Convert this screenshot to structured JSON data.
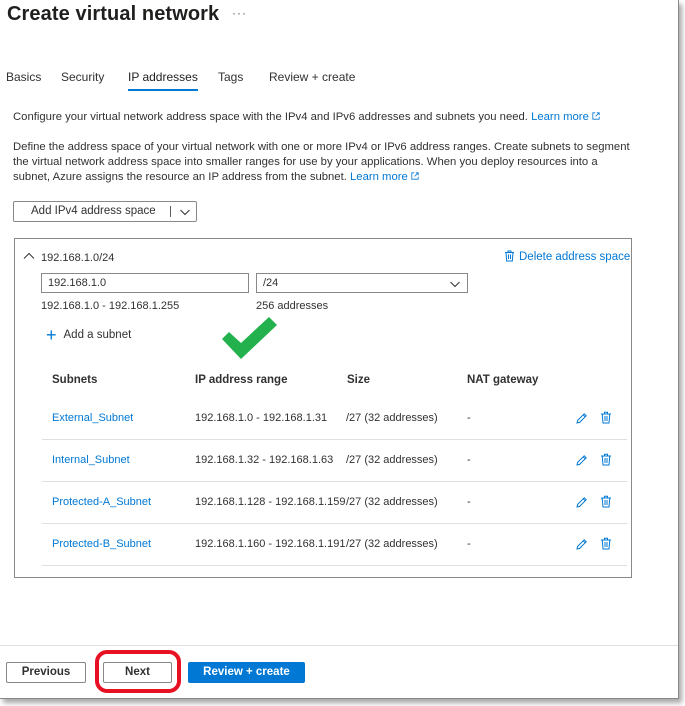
{
  "header": {
    "title": "Create virtual network",
    "more": "···"
  },
  "tabs": [
    {
      "label": "Basics",
      "active": false
    },
    {
      "label": "Security",
      "active": false
    },
    {
      "label": "IP addresses",
      "active": true
    },
    {
      "label": "Tags",
      "active": false
    },
    {
      "label": "Review + create",
      "active": false
    }
  ],
  "intro": {
    "text": "Configure your virtual network address space with the IPv4 and IPv6 addresses and subnets you need. ",
    "link": "Learn more"
  },
  "description": {
    "line1": "Define the address space of your virtual network with one or more IPv4 or IPv6 address ranges. Create subnets to segment",
    "line2": "the virtual network address space into smaller ranges for use by your applications. When you deploy resources into a",
    "line3": "subnet, Azure assigns the resource an IP address from the subnet. ",
    "link": "Learn more"
  },
  "add_space_button": "Add IPv4 address space",
  "address_space": {
    "name": "192.168.1.0/24",
    "delete_label": "Delete address space",
    "address_value": "192.168.1.0",
    "prefix_value": "/24",
    "range": "192.168.1.0 - 192.168.1.255",
    "count": "256 addresses",
    "add_subnet_label": "Add a subnet"
  },
  "subnet_table": {
    "headers": {
      "subnets": "Subnets",
      "ip_range": "IP address range",
      "size": "Size",
      "nat": "NAT gateway"
    },
    "rows": [
      {
        "name": "External_Subnet",
        "ip_range": "192.168.1.0 - 192.168.1.31",
        "size": "/27 (32 addresses)",
        "nat": "-"
      },
      {
        "name": "Internal_Subnet",
        "ip_range": "192.168.1.32 - 192.168.1.63",
        "size": "/27 (32 addresses)",
        "nat": "-"
      },
      {
        "name": "Protected-A_Subnet",
        "ip_range": "192.168.1.128 - 192.168.1.159",
        "size": "/27 (32 addresses)",
        "nat": "-"
      },
      {
        "name": "Protected-B_Subnet",
        "ip_range": "192.168.1.160 - 192.168.1.191",
        "size": "/27 (32 addresses)",
        "nat": "-"
      }
    ]
  },
  "footer": {
    "previous": "Previous",
    "next": "Next",
    "review": "Review + create"
  },
  "colors": {
    "accent": "#0078d4",
    "checkmark": "#22b14c",
    "highlight": "#e81123"
  },
  "icons": [
    "external-link-icon",
    "chevron-down-icon",
    "chevron-up-icon",
    "trash-icon",
    "pencil-icon",
    "plus-icon",
    "checkmark-icon"
  ]
}
